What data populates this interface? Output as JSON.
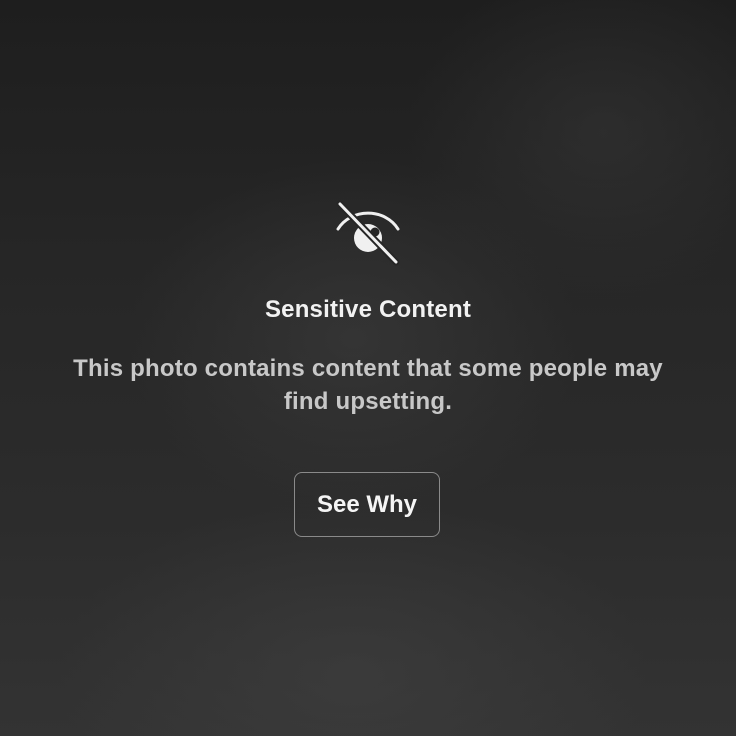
{
  "overlay": {
    "icon": "eye-slash-icon",
    "title": "Sensitive Content",
    "message": "This photo contains content that some people may find upsetting.",
    "button_label": "See Why"
  },
  "colors": {
    "background": "#262626",
    "title": "#f2f2f2",
    "message": "#c8c8c8",
    "button_border": "#8a8a8a",
    "button_text": "#f5f5f5"
  }
}
